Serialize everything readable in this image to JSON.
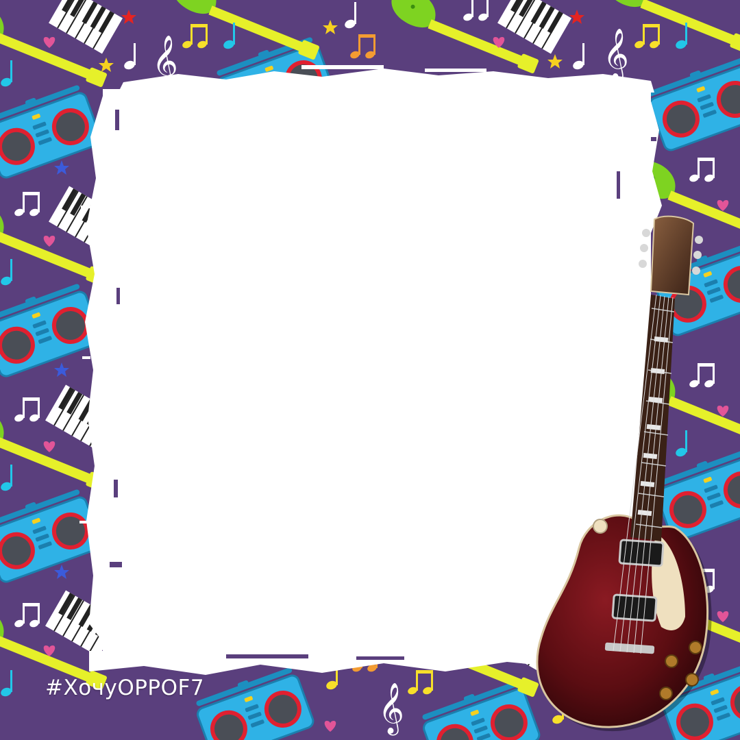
{
  "frame": {
    "hashtag": "#ХочуOPPOF7",
    "photo_area": "blank",
    "colors": {
      "background": "#5a3f7d",
      "photo_area": "#ffffff",
      "boombox": "#2fb2e6",
      "speaker_ring": "#e02030",
      "neck": "#e6f02a",
      "guitar_body_pattern": "#7ed321",
      "star_red": "#e52421",
      "star_yellow": "#f5d020",
      "star_blue": "#3b5bdb",
      "heart": "#e25598",
      "note_white": "#ffffff",
      "note_cyan": "#22c7e8",
      "note_yellow": "#f7e02a",
      "note_orange": "#f39c32",
      "les_paul_body": "#5b0d12",
      "les_paul_neck": "#3a2116"
    },
    "icons": [
      "boombox-icon",
      "keyboard-icon",
      "guitar-icon",
      "music-note-icon",
      "treble-clef-icon",
      "star-icon",
      "heart-icon",
      "electric-guitar-image"
    ]
  }
}
